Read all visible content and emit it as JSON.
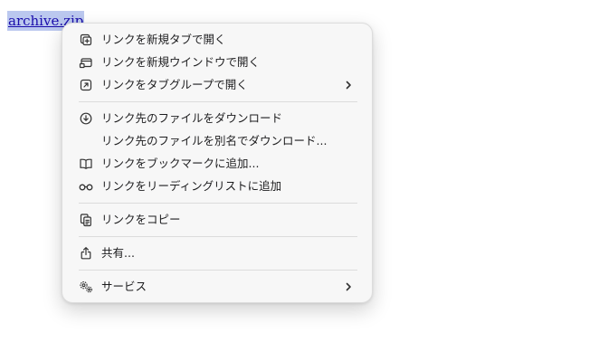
{
  "link": {
    "text": "archive.zip"
  },
  "menu": {
    "open_new_tab": "リンクを新規タブで開く",
    "open_new_window": "リンクを新規ウインドウで開く",
    "open_tab_group": "リンクをタブグループで開く",
    "download_linked_file": "リンク先のファイルをダウンロード",
    "download_linked_file_as": "リンク先のファイルを別名でダウンロード...",
    "add_bookmark": "リンクをブックマークに追加...",
    "add_reading_list": "リンクをリーディングリストに追加",
    "copy_link": "リンクをコピー",
    "share": "共有...",
    "services": "サービス"
  },
  "icons": {
    "open_new_tab": "new-tab-icon",
    "open_new_window": "new-window-icon",
    "open_tab_group": "tab-group-icon",
    "download_linked_file": "download-icon",
    "add_bookmark": "book-icon",
    "add_reading_list": "reading-glasses-icon",
    "copy_link": "copy-icon",
    "share": "share-icon",
    "services": "services-gear-icon",
    "submenu": "chevron-right-icon"
  }
}
